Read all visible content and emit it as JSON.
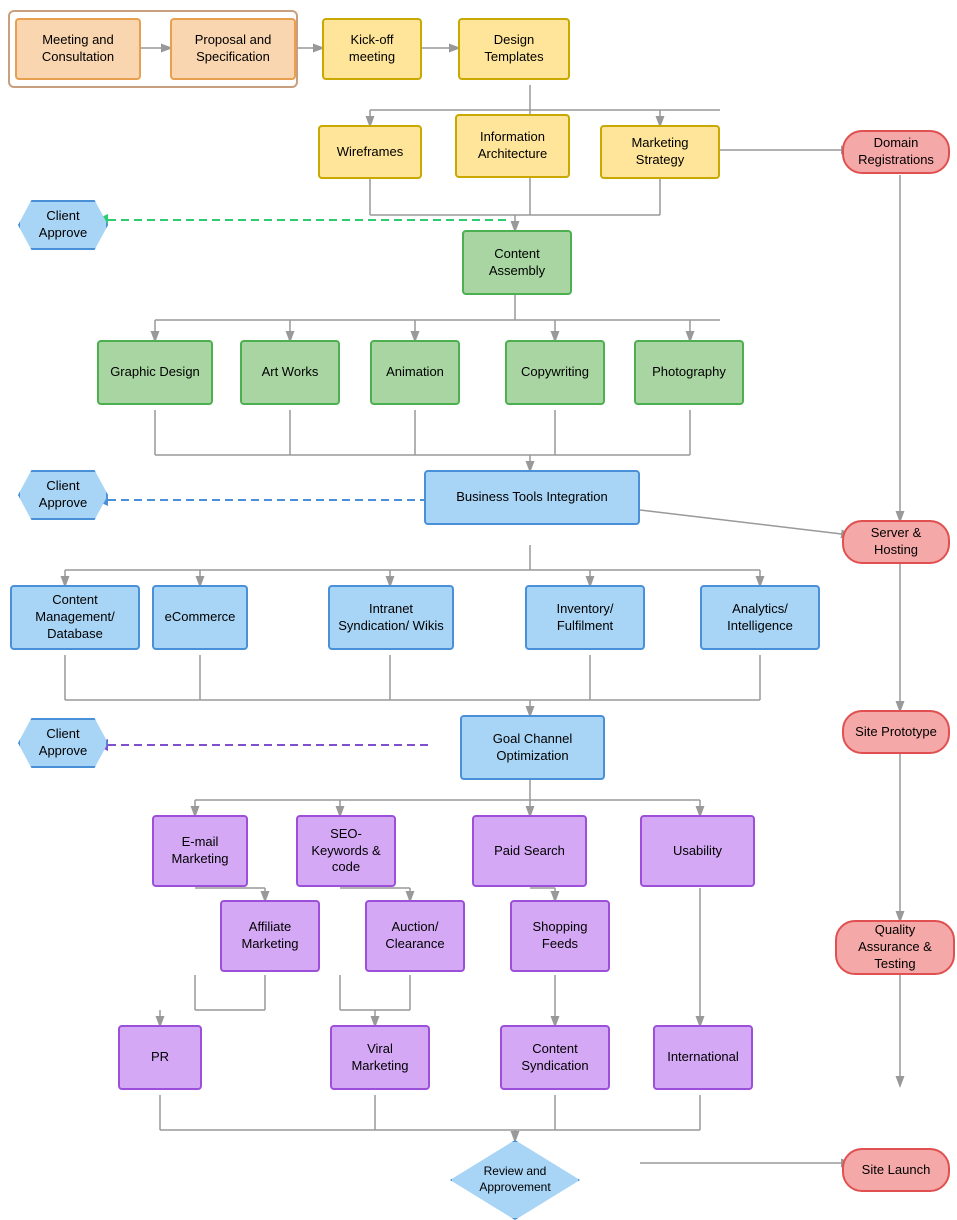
{
  "nodes": {
    "meeting": {
      "label": "Meeting and\nConsultation"
    },
    "proposal": {
      "label": "Proposal and\nSpecification"
    },
    "kickoff": {
      "label": "Kick-off\nmeeting"
    },
    "design_templates": {
      "label": "Design\nTemplates"
    },
    "wireframes": {
      "label": "Wireframes"
    },
    "info_arch": {
      "label": "Information\nArchitecture"
    },
    "marketing_strategy": {
      "label": "Marketing\nStrategy"
    },
    "domain_reg": {
      "label": "Domain\nRegistrations"
    },
    "client_approve1": {
      "label": "Client\nApprove"
    },
    "content_assembly": {
      "label": "Content\nAssembly"
    },
    "graphic_design": {
      "label": "Graphic\nDesign"
    },
    "art_works": {
      "label": "Art Works"
    },
    "animation": {
      "label": "Animation"
    },
    "copywriting": {
      "label": "Copywriting"
    },
    "photography": {
      "label": "Photography"
    },
    "client_approve2": {
      "label": "Client\nApprove"
    },
    "biz_tools": {
      "label": "Business Tools Integration"
    },
    "content_mgmt": {
      "label": "Content Management/\nDatabase"
    },
    "ecommerce": {
      "label": "eCommerce"
    },
    "intranet": {
      "label": "Intranet Syndication/\nWikis"
    },
    "inventory": {
      "label": "Inventory/\nFulfilment"
    },
    "analytics": {
      "label": "Analytics/\nIntelligence"
    },
    "server_hosting": {
      "label": "Server & Hosting"
    },
    "client_approve3": {
      "label": "Client\nApprove"
    },
    "goal_channel": {
      "label": "Goal Channel\nOptimization"
    },
    "email_mktg": {
      "label": "E-mail\nMarketing"
    },
    "seo": {
      "label": "SEO-\nKeywords &\ncode"
    },
    "paid_search": {
      "label": "Paid Search"
    },
    "usability": {
      "label": "Usability"
    },
    "affiliate": {
      "label": "Affiliate\nMarketing"
    },
    "auction": {
      "label": "Auction/\nClearance"
    },
    "shopping_feeds": {
      "label": "Shopping\nFeeds"
    },
    "pr": {
      "label": "PR"
    },
    "viral": {
      "label": "Viral\nMarketing"
    },
    "content_synd": {
      "label": "Content\nSyndication"
    },
    "international": {
      "label": "International"
    },
    "site_prototype": {
      "label": "Site Prototype"
    },
    "qa_testing": {
      "label": "Quality Assurance\n& Testing"
    },
    "review": {
      "label": "Review and\nApprovement"
    },
    "site_launch": {
      "label": "Site Launch"
    }
  }
}
